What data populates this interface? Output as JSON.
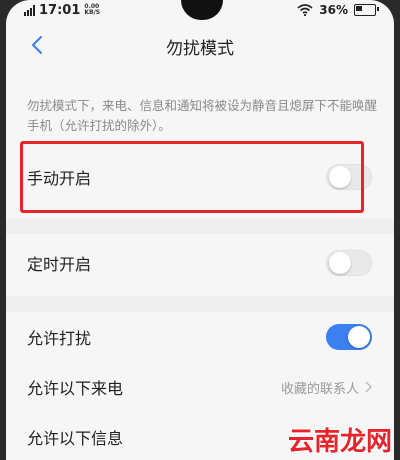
{
  "status_bar": {
    "time": "17:01",
    "speed": "0.00",
    "speed_unit": "KB/S",
    "battery": "36%"
  },
  "header": {
    "title": "勿扰模式",
    "back_icon": "chevron-left-icon"
  },
  "description": "勿扰模式下，来电、信息和通知将被设为静音且熄屏下不能唤醒手机（允许打扰的除外）。",
  "settings": {
    "manual_on": {
      "label": "手动开启",
      "enabled": false
    },
    "scheduled_on": {
      "label": "定时开启",
      "enabled": false
    },
    "allow_disturb": {
      "label": "允许打扰",
      "enabled": true
    },
    "allow_calls": {
      "label": "允许以下来电",
      "value": "收藏的联系人"
    },
    "allow_messages": {
      "label": "允许以下信息"
    }
  },
  "colors": {
    "accent": "#3c7ff0",
    "highlight": "#e8242a"
  },
  "watermark": "云南龙网"
}
